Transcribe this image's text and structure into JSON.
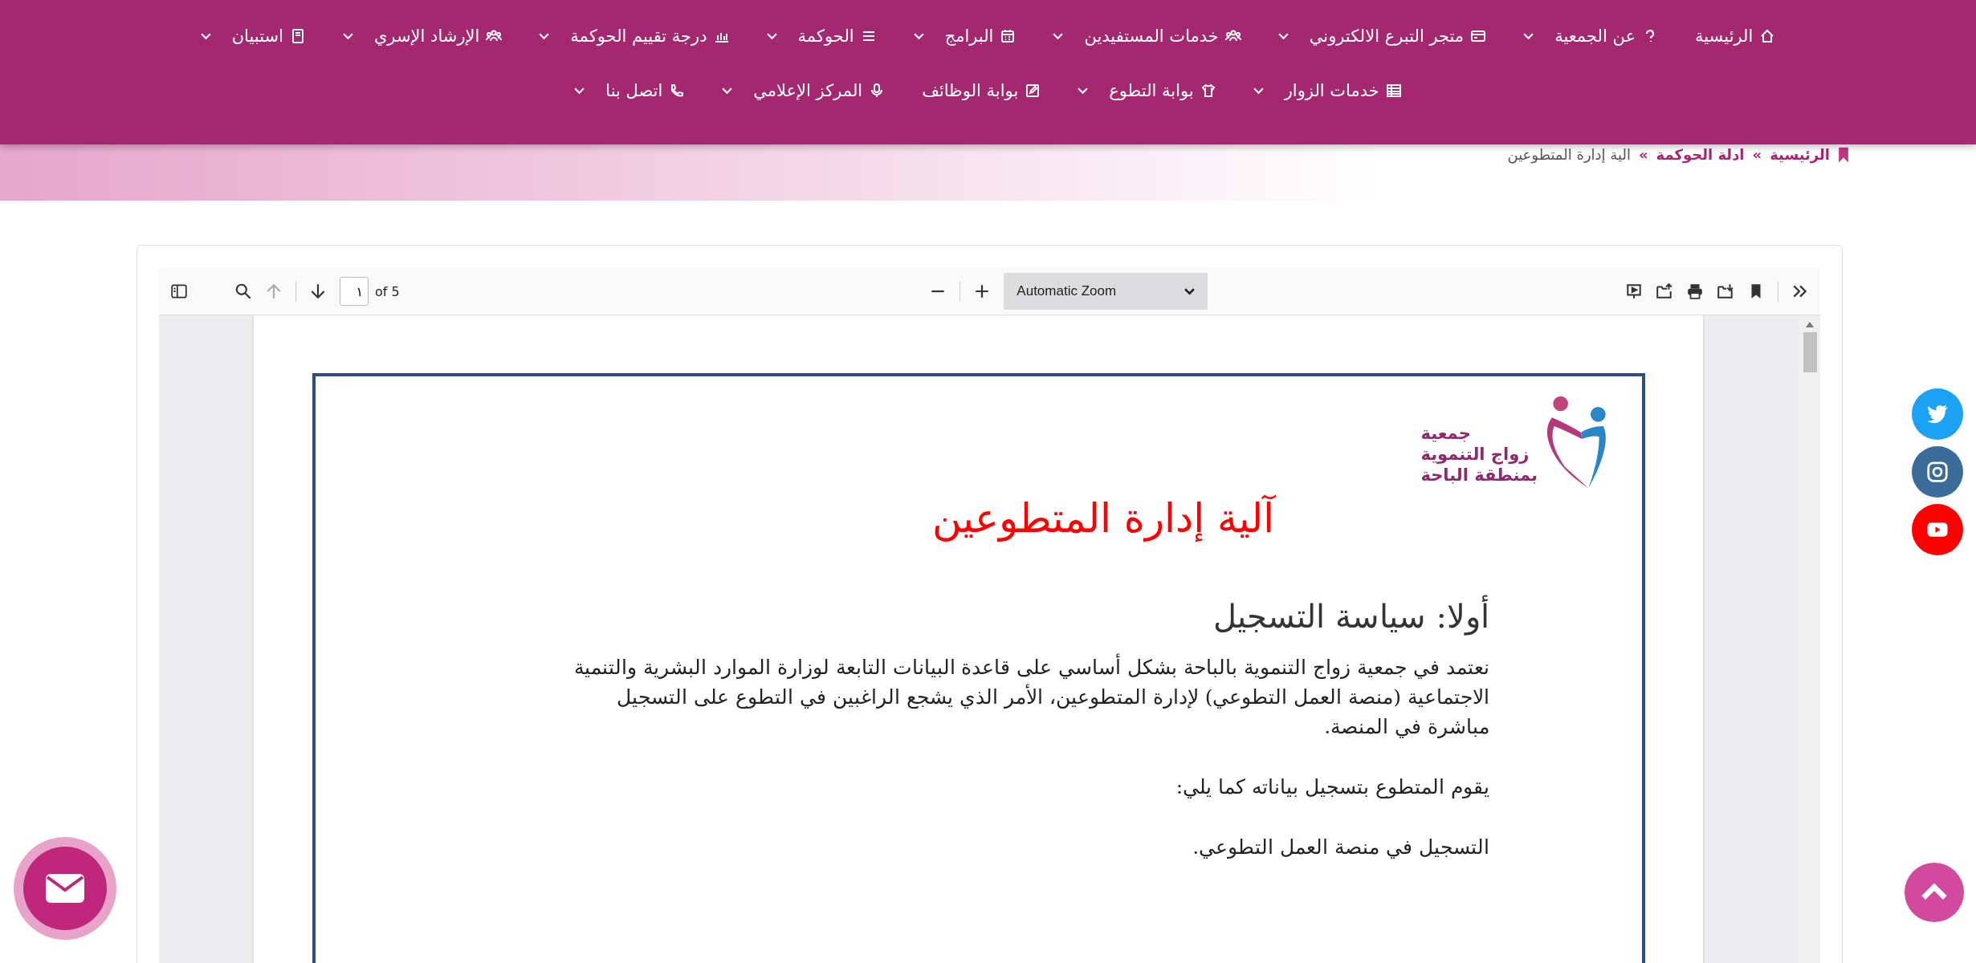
{
  "nav": {
    "items": [
      {
        "label": "الرئيسية",
        "dropdown": false
      },
      {
        "label": "عن الجمعية",
        "dropdown": true
      },
      {
        "label": "متجر التبرع الالكتروني",
        "dropdown": true
      },
      {
        "label": "خدمات المستفيدين",
        "dropdown": true
      },
      {
        "label": "البرامج",
        "dropdown": true
      },
      {
        "label": "الحوكمة",
        "dropdown": true
      },
      {
        "label": "درجة تقييم الحوكمة",
        "dropdown": true
      },
      {
        "label": "الإرشاد الإسري",
        "dropdown": true
      },
      {
        "label": "استبيان",
        "dropdown": true
      },
      {
        "label": "خدمات الزوار",
        "dropdown": true
      },
      {
        "label": "بوابة التطوع",
        "dropdown": true
      },
      {
        "label": "بوابة الوظائف",
        "dropdown": false
      },
      {
        "label": "المركز الإعلامي",
        "dropdown": true
      },
      {
        "label": "اتصل بنا",
        "dropdown": true
      }
    ]
  },
  "breadcrumb": [
    {
      "kind": "link",
      "text": "الرئيسية"
    },
    {
      "kind": "separator",
      "text": "»"
    },
    {
      "kind": "link",
      "text": "ادلة الحوكمة"
    },
    {
      "kind": "separator",
      "text": "»"
    },
    {
      "kind": "current",
      "text": "الية إدارة المتطوعين"
    }
  ],
  "pdf_viewer": {
    "page_number": "١",
    "page_count": "of 5",
    "zoom": "Automatic Zoom",
    "previous_disabled": true,
    "document": {
      "logo_lines": [
        "جمعية",
        "زواج التنموية",
        "بمنطقة الباحة"
      ],
      "title": "آلية إدارة المتطوعين",
      "heading": "أولا: سياسة التسجيل",
      "paragraphs": [
        "نعتمد في جمعية زواج التنموية بالباحة  بشكل أساسي على قاعدة البيانات التابعة لوزارة الموارد البشرية والتنمية الاجتماعية (منصة العمل التطوعي) لإدارة المتطوعين، الأمر الذي يشجع الراغبين في التطوع على التسجيل مباشرة في المنصة.",
        "يقوم المتطوع بتسجيل بياناته كما يلي:",
        "التسجيل في منصة العمل التطوعي."
      ]
    }
  }
}
